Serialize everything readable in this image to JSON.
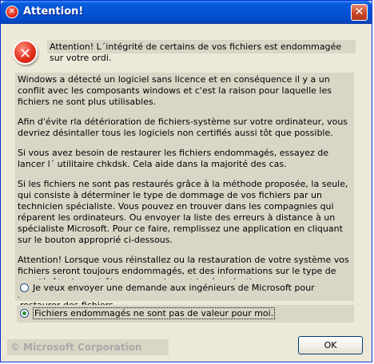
{
  "window": {
    "title": "Attention!",
    "close_glyph": "✕",
    "icon": "error-icon"
  },
  "dialog": {
    "headline": "Attention! L´intégrité de certains de vos fichiers est endommagée sur votre ordi.",
    "paragraphs": [
      "Windows a détecté un logiciel sans licence et en conséquence il y a un conflit avec les composants windows et c'est la raison pour laquelle les fichiers ne sont plus utilisables.",
      "Afin d'évite rla détérioration de fichiers-système sur votre ordinateur, vous devriez désintaller tous les logiciels non certifiés aussi tôt que possible.",
      "Si vous avez besoin de restaurer les fichiers endommagés, essayez de lancer l´ utilitaire chkdsk. Cela aide dans la majorité des cas.",
      "Si les fichiers ne sont pas restaurés grâce à la méthode proposée, la seule, qui consiste à déterminer le type de dommage de vos fichiers par un technicien spécialiste. Vous pouvez en trouver dans les compagnies qui réparent les ordinateurs. Ou envoyer la liste des erreurs à distance à un spécialiste Microsoft. Pour ce faire, remplissez une application en cliquant sur le bouton approprié ci-dessous.",
      "Attention! Lorsque vous réinstallez ou la restauration de votre système vos fichiers seront toujours endommagés, et des informations sur le type de vos dégâts de contrôle sront perdues et la récupération ne sera pas possible."
    ],
    "options": [
      {
        "label": "Je veux envoyer une demande aux ingénieurs de Microsoft pour restaurer des fichiers",
        "selected": false
      },
      {
        "label": "Fichiers endommagés ne sont pas de valeur pour moi.",
        "selected": true
      }
    ],
    "copyright": "© Microsoft Corporation",
    "ok_label": "OK"
  },
  "colors": {
    "titlebar": "#0453d6",
    "dialog_bg": "#ece9d8",
    "text_bg": "#dad6c6",
    "error_red": "#e1301a"
  }
}
